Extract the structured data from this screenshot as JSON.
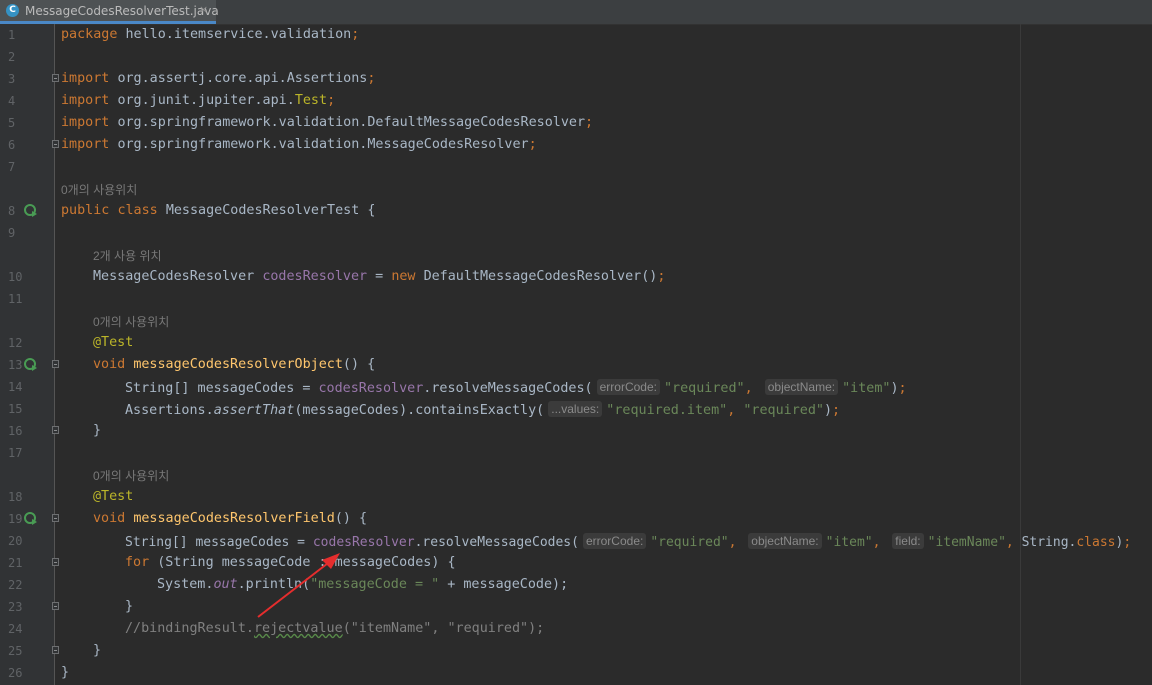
{
  "tab": {
    "filename": "MessageCodesResolverTest.java",
    "close": "×",
    "icon": "java-class-icon"
  },
  "lines": {
    "n1": "1",
    "n2": "2",
    "n3": "3",
    "n4": "4",
    "n5": "5",
    "n6": "6",
    "n7": "7",
    "n8": "8",
    "n9": "9",
    "n10": "10",
    "n11": "11",
    "n12": "12",
    "n13": "13",
    "n14": "14",
    "n15": "15",
    "n16": "16",
    "n17": "17",
    "n18": "18",
    "n19": "19",
    "n20": "20",
    "n21": "21",
    "n22": "22",
    "n23": "23",
    "n24": "24",
    "n25": "25",
    "n26": "26"
  },
  "hints": {
    "usage_class": "0개의 사용위치",
    "usage_field": "2개 사용 위치",
    "usage_m1": "0개의 사용위치",
    "usage_m2": "0개의 사용위치"
  },
  "code": {
    "package_kw": "package",
    "package_name": "hello.itemservice.validation",
    "import_kw": "import",
    "imp1": "org.assertj.core.api.Assertions",
    "imp2_pkg": "org.junit.jupiter.api.",
    "imp2_cls": "Test",
    "imp3": "org.springframework.validation.DefaultMessageCodesResolver",
    "imp4": "org.springframework.validation.MessageCodesResolver",
    "public_kw": "public",
    "class_kw": "class",
    "class_name": "MessageCodesResolverTest",
    "field_type": "MessageCodesResolver",
    "field_name": "codesResolver",
    "new_kw": "new",
    "field_init": "DefaultMessageCodesResolver",
    "test_ann": "@Test",
    "void_kw": "void",
    "m1_name": "messageCodesResolverObject",
    "m2_name": "messageCodesResolverField",
    "string_arr": "String[] messageCodes = ",
    "resolve": "resolveMessageCodes(",
    "hint_errorCode": "errorCode:",
    "hint_objectName": "objectName:",
    "hint_values": "...values:",
    "hint_field": "field:",
    "s_required": "\"required\"",
    "s_item": "\"item\"",
    "s_required_item": "\"required.item\"",
    "s_itemName": "\"itemName\"",
    "assertions": "Assertions.",
    "assert_that": "assertThat",
    "assert_rest": "(messageCodes).containsExactly(",
    "for_kw": "for",
    "for_body": "(String messageCode : messageCodes) {",
    "system": "System.",
    "out": "out",
    "println": ".println(",
    "s_messageCode": "\"messageCode = \"",
    "concat": " + messageCode);",
    "comment_a": "//bindingResult.",
    "comment_b": "rejectvalue",
    "comment_c": "(\"itemName\", \"required\");",
    "string_class": "String.",
    "class_lit": "class"
  },
  "colors": {
    "arrow": "#e52d2d",
    "keyword": "#cc7832",
    "string": "#6a8759",
    "field": "#9876aa",
    "method": "#ffc66d"
  }
}
